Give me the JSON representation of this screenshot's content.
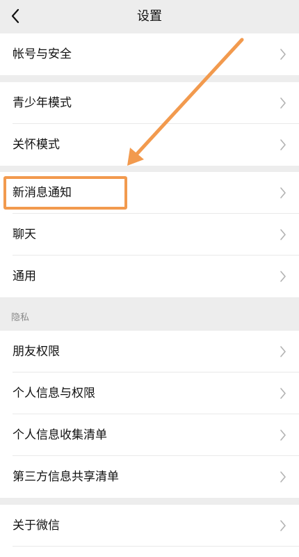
{
  "header": {
    "title": "设置"
  },
  "groups": [
    {
      "items": [
        {
          "label": "帐号与安全"
        }
      ]
    },
    {
      "items": [
        {
          "label": "青少年模式"
        },
        {
          "label": "关怀模式"
        }
      ]
    },
    {
      "items": [
        {
          "label": "新消息通知"
        },
        {
          "label": "聊天"
        },
        {
          "label": "通用"
        }
      ]
    },
    {
      "section_title": "隐私",
      "items": [
        {
          "label": "朋友权限"
        },
        {
          "label": "个人信息与权限"
        },
        {
          "label": "个人信息收集清单"
        },
        {
          "label": "第三方信息共享清单"
        }
      ]
    },
    {
      "items": [
        {
          "label": "关于微信"
        }
      ]
    }
  ],
  "icons": {
    "back": "chevron-left-icon",
    "row": "chevron-right-icon"
  },
  "colors": {
    "background": "#ededed",
    "highlight": "#f29a4e"
  }
}
